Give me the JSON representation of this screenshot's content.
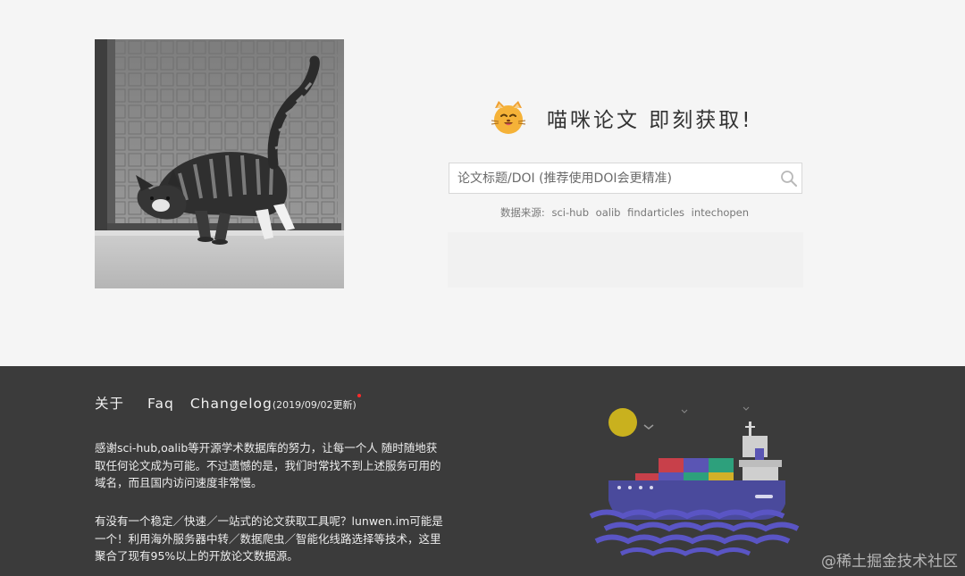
{
  "hero": {
    "brand_logo_icon": "cat-face-icon",
    "title": "喵咪论文 即刻获取!",
    "search": {
      "placeholder": "论文标题/DOI (推荐使用DOI会更精准)",
      "value": "",
      "icon": "search-icon"
    },
    "sources": {
      "prefix": "数据来源:",
      "items": [
        "sci-hub",
        "oalib",
        "findarticles",
        "intechopen"
      ]
    }
  },
  "footer": {
    "nav": {
      "about": "关于",
      "faq": "Faq",
      "changelog": "Changelog",
      "changelog_date": "(2019/09/02更新)"
    },
    "paragraph1": "感谢sci-hub,oalib等开源学术数据库的努力，让每一个人 随时随地获取任何论文成为可能。不过遗憾的是，我们时常找不到上述服务可用的域名，而且国内访问速度非常慢。",
    "paragraph2": "有没有一个稳定／快速／一站式的论文获取工具呢？lunwen.im可能是一个！利用海外服务器中转／数据爬虫／智能化线路选择等技术，这里聚合了现有95%以上的开放论文数据源。",
    "watermark": "@稀土掘金技术社区"
  },
  "colors": {
    "page_bg": "#f5f5f5",
    "footer_bg": "#3b3b3b",
    "ship_hull": "#4a4a9c",
    "sun": "#c9b11e",
    "new_dot": "#ff2a2a"
  }
}
